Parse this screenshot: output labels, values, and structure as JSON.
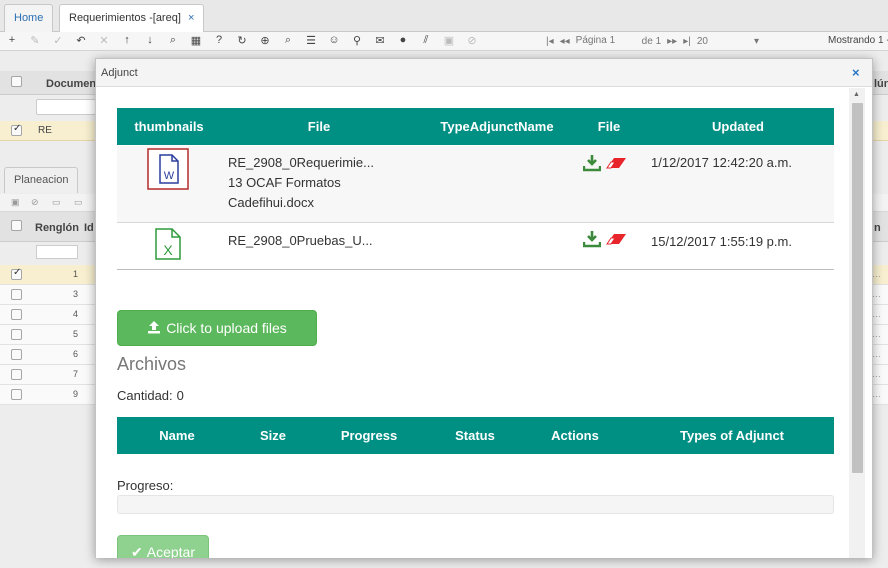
{
  "tabs": {
    "home_label": "Home",
    "req_label": "Requerimientos -[areq]",
    "close_glyph": "×"
  },
  "toolbar": {
    "page_label": "Página 1",
    "of_label": "de 1",
    "page_size": "20",
    "showing": "Mostrando 1 -"
  },
  "grid": {
    "header_document": "Documen",
    "header_right": "lún",
    "selected_row_text": "RE"
  },
  "subgrid": {
    "tab_label": "Planeacion",
    "header_row": "Renglón",
    "header_id": "Id",
    "header_right": "n",
    "row_numbers": [
      "1",
      "3",
      "4",
      "5",
      "6",
      "7",
      "9"
    ]
  },
  "modal": {
    "title": "Adjunct",
    "close_icon": "×",
    "attachments_table": {
      "columns": [
        "thumbnails",
        "File",
        "TypeAdjunctName",
        "File",
        "Updated"
      ],
      "rows": [
        {
          "thumbnail_icon": "word-doc-icon",
          "file_line1": "RE_2908_0Requerimie...",
          "file_line2": "13 OCAF Formatos",
          "file_line3": "Cadefihui.docx",
          "type_name": "",
          "updated": "1/12/2017 12:42:20 a.m."
        },
        {
          "thumbnail_icon": "excel-doc-icon",
          "file_line1": "RE_2908_0Pruebas_U...",
          "file_line2": "",
          "file_line3": "",
          "type_name": "",
          "updated": "15/12/2017 1:55:19 p.m."
        }
      ]
    },
    "upload_button": "Click to upload files",
    "archivos_title": "Archivos",
    "cantidad_label": "Cantidad:",
    "cantidad_value": "0",
    "queue_columns": [
      "Name",
      "Size",
      "Progress",
      "Status",
      "Actions",
      "Types of Adjunct"
    ],
    "progreso_label": "Progreso:",
    "progress": 0,
    "aceptar_label": "Aceptar"
  },
  "colors": {
    "header_teal": "#008f83",
    "upload_green": "#5cb85c",
    "download_green": "#3c8a3c",
    "delete_red": "#e8252b",
    "word_blue": "#2b3f9e",
    "excel_green": "#2f9a3a",
    "selected_row": "#f7efcf"
  }
}
